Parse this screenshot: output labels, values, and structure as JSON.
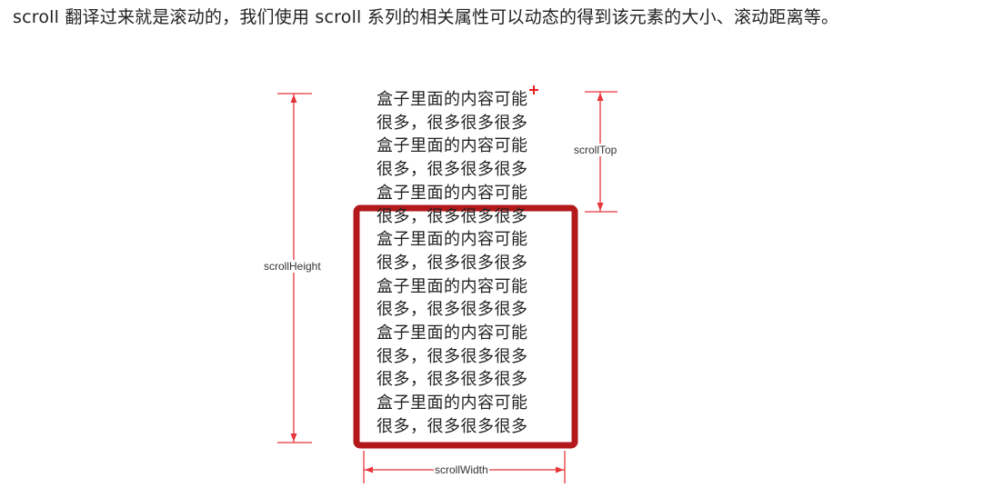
{
  "heading": "scroll 翻译过来就是滚动的，我们使用 scroll 系列的相关属性可以动态的得到该元素的大小、滚动距离等。",
  "content_lines": [
    "盒子里面的内容可能",
    "很多，很多很多很多",
    "盒子里面的内容可能",
    "很多，很多很多很多",
    "盒子里面的内容可能",
    "很多，很多很多很多",
    "盒子里面的内容可能",
    "很多，很多很多很多",
    "盒子里面的内容可能",
    "很多，很多很多很多",
    "盒子里面的内容可能",
    "很多，很多很多很多",
    "很多，很多很多很多",
    "盒子里面的内容可能",
    "很多，很多很多很多"
  ],
  "labels": {
    "scroll_height": "scrollHeight",
    "scroll_top": "scrollTop",
    "scroll_width": "scrollWidth"
  },
  "colors": {
    "box_border": "#b3191b",
    "dimension_lines": "#e8353a",
    "text": "#222222"
  }
}
